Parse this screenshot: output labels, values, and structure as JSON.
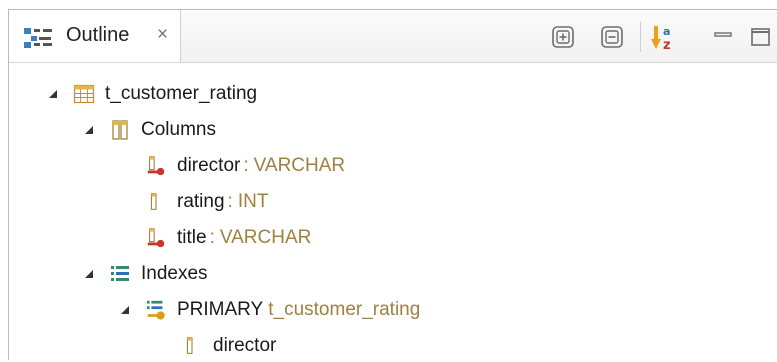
{
  "tab": {
    "title": "Outline",
    "close": "×"
  },
  "toolbar": {
    "expand_all": "expand-all",
    "collapse_all": "collapse-all",
    "sort": "sort-alphabetically",
    "minimize": "minimize",
    "maximize": "maximize"
  },
  "tree": {
    "table": {
      "name": "t_customer_rating"
    },
    "columns": {
      "label": "Columns",
      "items": [
        {
          "name": "director",
          "type": "VARCHAR",
          "key": true
        },
        {
          "name": "rating",
          "type": "INT",
          "key": false
        },
        {
          "name": "title",
          "type": "VARCHAR",
          "key": true
        }
      ]
    },
    "indexes": {
      "label": "Indexes",
      "primary": {
        "name": "PRIMARY",
        "table": "t_customer_rating",
        "columns": [
          "director"
        ]
      }
    }
  },
  "colors": {
    "type_text": "#a08040",
    "key_red": "#c8352d",
    "index_gold": "#d4a017",
    "index_green": "#3a8a6a"
  },
  "separator": ":"
}
